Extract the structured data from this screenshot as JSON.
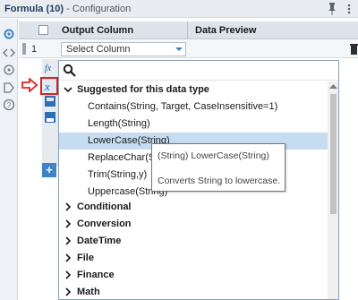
{
  "header": {
    "title": "Formula (10)",
    "subtitle": "- Configuration"
  },
  "grid": {
    "col_output": "Output Column",
    "col_preview": "Data Preview",
    "row_number": "1",
    "select_value": "Select Column"
  },
  "dropdown": {
    "search_value": "",
    "suggested_label": "Suggested for this data type",
    "functions": [
      "Contains(String, Target, CaseInsensitive=1)",
      "Length(String)",
      "LowerCase(String)",
      "ReplaceChar(Str",
      "Trim(String,y)",
      "Uppercase(String)"
    ],
    "selected_function": "LowerCase(String)",
    "categories": [
      "Conditional",
      "Conversion",
      "DateTime",
      "File",
      "Finance",
      "Math"
    ]
  },
  "tooltip": {
    "signature": "(String) LowerCase(String)",
    "description": "Converts String to lowercase."
  },
  "add_button_label": "+",
  "colors": {
    "accent": "#3f83c6",
    "selection": "#c5dcf1",
    "highlight_red": "#e02020"
  },
  "icons": {
    "sidebar": [
      "gear-icon",
      "code-icon",
      "tag-icon",
      "settings-icon",
      "help-icon"
    ],
    "editor": [
      "fx-icon",
      "variable-x-icon",
      "save-icon",
      "disk-icon"
    ]
  }
}
